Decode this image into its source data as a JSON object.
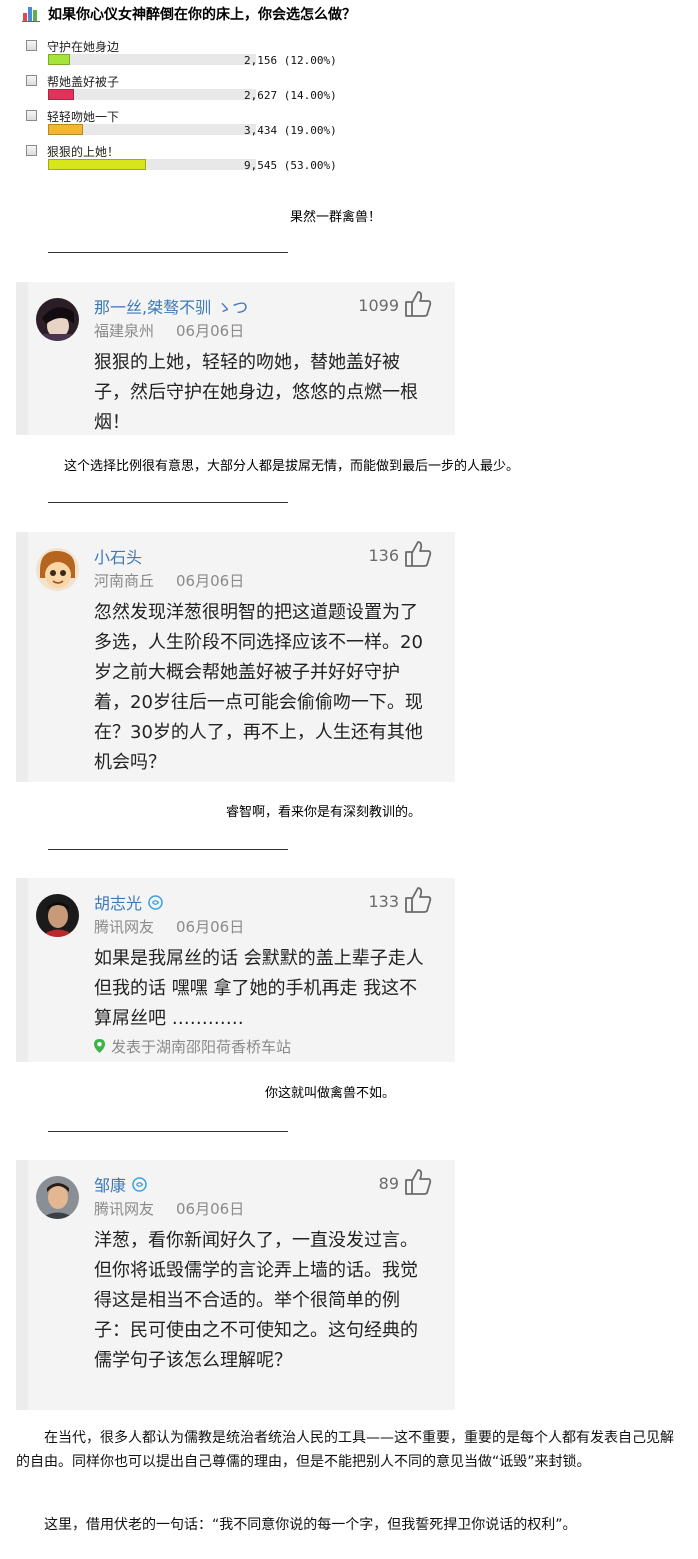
{
  "poll": {
    "title": "如果你心仪女神醉倒在你的床上，你会选怎么做？",
    "options": [
      {
        "label": "守护在她身边",
        "count": "2,156",
        "percent": "(12.00%)",
        "fraction": 0.12,
        "color": "#a6e43a"
      },
      {
        "label": "帮她盖好被子",
        "count": "2,627",
        "percent": "(14.00%)",
        "fraction": 0.14,
        "color": "#e0325a"
      },
      {
        "label": "轻轻吻她一下",
        "count": "3,434",
        "percent": "(19.00%)",
        "fraction": 0.19,
        "color": "#f4b630"
      },
      {
        "label": "狠狠的上她！",
        "count": "9,545",
        "percent": "(53.00%)",
        "fraction": 0.53,
        "color": "#d6e61a"
      }
    ]
  },
  "captions": [
    "果然一群禽兽！",
    "这个选择比例很有意思，大部分人都是拔屌无情，而能做到最后一步的人最少。",
    "睿智啊，看来你是有深刻教训的。",
    "你这就叫做禽兽不如。"
  ],
  "comments": [
    {
      "name": "那一丝,桀骜不驯 ゝつ",
      "place": "福建泉州",
      "date": "06月06日",
      "likes": "1099",
      "text": "狠狠的上她，轻轻的吻她，替她盖好被子，然后守护在她身边，悠悠的点燃一根烟！"
    },
    {
      "name": "小石头",
      "place": "河南商丘",
      "date": "06月06日",
      "likes": "136",
      "text": "忽然发现洋葱很明智的把这道题设置为了多选，人生阶段不同选择应该不一样。20岁之前大概会帮她盖好被子并好好守护着，20岁往后一点可能会偷偷吻一下。现在？30岁的人了，再不上，人生还有其他机会吗？"
    },
    {
      "name": "胡志光",
      "place": "腾讯网友",
      "date": "06月06日",
      "likes": "133",
      "text": "如果是我屌丝的话 会默默的盖上辈子走人 但我的话 嘿嘿 拿了她的手机再走 我这不算屌丝吧 …………",
      "location": "发表于湖南邵阳荷香桥车站"
    },
    {
      "name": "邹康",
      "place": "腾讯网友",
      "date": "06月06日",
      "likes": "89",
      "text": "洋葱，看你新闻好久了，一直没发过言。但你将诋毁儒学的言论弄上墙的话。我觉得这是相当不合适的。举个很简单的例子：民可使由之不可使知之。这句经典的儒学句子该怎么理解呢？"
    }
  ],
  "paragraphs": [
    "在当代，很多人都认为儒教是统治者统治人民的工具——这不重要，重要的是每个人都有发表自己见解的自由。同样你也可以提出自己尊儒的理由，但是不能把别人不同的意见当做“诋毁”来封锁。",
    "这里，借用伏老的一句话：“我不同意你说的每一个字，但我誓死捍卫你说话的权利”。"
  ],
  "icons": {
    "poll": "bar-chart-icon",
    "checkbox": "checkbox-icon",
    "like": "thumbs-up-icon",
    "verified": "verified-icon",
    "location": "location-pin-icon"
  }
}
